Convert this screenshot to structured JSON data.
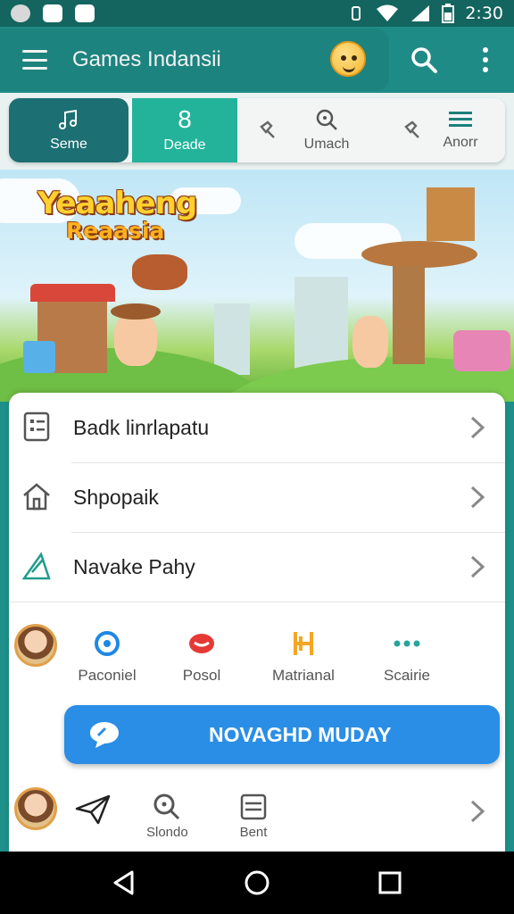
{
  "status_bar": {
    "time": "2:30"
  },
  "app_bar": {
    "title": "Games Indansii"
  },
  "tabs": [
    {
      "label": "Seme",
      "icon": "music-note-icon"
    },
    {
      "label": "Deade",
      "value": "8"
    },
    {
      "label": "Umach",
      "icon": "search-icon"
    },
    {
      "label": "Anorr",
      "icon": "menu-icon"
    }
  ],
  "hero": {
    "title_line1": "Yeaaheng",
    "title_line2": "Reaasia"
  },
  "list_items": [
    {
      "label": "Badk linrlapatu",
      "icon": "clipboard-icon"
    },
    {
      "label": "Shpopaik",
      "icon": "home-icon"
    },
    {
      "label": "Navake Pahy",
      "icon": "triangle-ruler-icon"
    }
  ],
  "quick_actions": [
    {
      "label": "Paconiel",
      "icon": "at-icon",
      "color": "#1e88e5"
    },
    {
      "label": "Posol",
      "icon": "lips-icon",
      "color": "#e53935"
    },
    {
      "label": "Matrianal",
      "icon": "h-icon",
      "color": "#f5a623"
    },
    {
      "label": "Scairie",
      "icon": "dots-icon",
      "color": "#26a69a"
    }
  ],
  "cta": {
    "label": "NOVAGHD MUDAY"
  },
  "bottom_actions": [
    {
      "label": "",
      "icon": "send-icon"
    },
    {
      "label": "Slondo",
      "icon": "search-icon"
    },
    {
      "label": "Bent",
      "icon": "list-icon"
    }
  ],
  "colors": {
    "app_bar": "#1f8b86",
    "tab_active": "#1c6f72",
    "tab_accent": "#23b39b",
    "cta": "#2a8ee6"
  }
}
